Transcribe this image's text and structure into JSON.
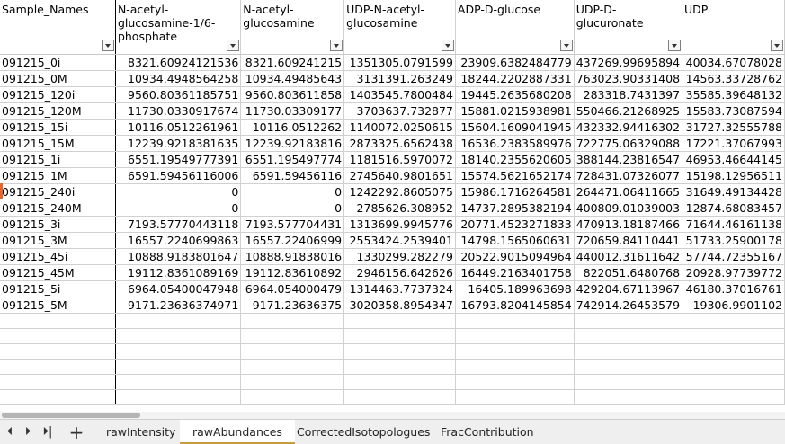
{
  "headers": [
    "Sample_Names",
    "N-acetyl-glucosamine-1/6-phosphate",
    "N-acetyl-glucosamine",
    "UDP-N-acetyl-glucosamine",
    "ADP-D-glucose",
    "UDP-D-glucuronate",
    "UDP"
  ],
  "rows": [
    [
      "091215_0i",
      "8321.60924121536",
      "8321.609241215",
      "1351305.0791599",
      "23909.6382484779",
      "437269.99695894",
      "40034.67078028"
    ],
    [
      "091215_0M",
      "10934.4948564258",
      "10934.49485643",
      "3131391.263249",
      "18244.2202887331",
      "763023.90331408",
      "14563.33728762"
    ],
    [
      "091215_120i",
      "9560.80361185751",
      "9560.803611858",
      "1403545.7800484",
      "19445.2635680208",
      "283318.7431397",
      "35585.39648132"
    ],
    [
      "091215_120M",
      "11730.0330917674",
      "11730.03309177",
      "3703637.732877",
      "15881.0215938981",
      "550466.21268925",
      "15583.73087594"
    ],
    [
      "091215_15i",
      "10116.0512261961",
      "10116.0512262",
      "1140072.0250615",
      "15604.1609041945",
      "432332.94416302",
      "31727.32555788"
    ],
    [
      "091215_15M",
      "12239.9218381635",
      "12239.92183816",
      "2873325.6562438",
      "16536.2383589976",
      "722775.06329088",
      "17221.37067993"
    ],
    [
      "091215_1i",
      "6551.19549777391",
      "6551.195497774",
      "1181516.5970072",
      "18140.2355620605",
      "388144.23816547",
      "46953.46644145"
    ],
    [
      "091215_1M",
      "6591.59456116006",
      "6591.59456116",
      "2745640.9801651",
      "15574.5621652174",
      "728431.07326077",
      "15198.12956511"
    ],
    [
      "091215_240i",
      "0",
      "0",
      "1242292.8605075",
      "15986.1716264581",
      "264471.06411665",
      "31649.49134428"
    ],
    [
      "091215_240M",
      "0",
      "0",
      "2785626.308952",
      "14737.2895382194",
      "400809.01039003",
      "12874.68083457"
    ],
    [
      "091215_3i",
      "7193.57770443118",
      "7193.577704431",
      "1313699.9945776",
      "20771.4523271833",
      "470913.18187466",
      "71644.46161138"
    ],
    [
      "091215_3M",
      "16557.2240699863",
      "16557.22406999",
      "2553424.2539401",
      "14798.1565060631",
      "720659.84110441",
      "51733.25900178"
    ],
    [
      "091215_45i",
      "10888.9183801647",
      "10888.91838016",
      "1330299.282279",
      "20522.9015094964",
      "440012.31611642",
      "57744.72355167"
    ],
    [
      "091215_45M",
      "19112.8361089169",
      "19112.83610892",
      "2946156.642626",
      "16449.2163401758",
      "822051.6480768",
      "20928.97739772"
    ],
    [
      "091215_5i",
      "6964.05400047948",
      "6964.054000479",
      "1314463.7737324",
      "16405.189963698",
      "429204.67113967",
      "46180.37016761"
    ],
    [
      "091215_5M",
      "9171.23636374971",
      "9171.23636375",
      "3020358.8954347",
      "16793.8204145854",
      "742914.26453579",
      "19306.9901102"
    ]
  ],
  "tabs": [
    "rawIntensity",
    "rawAbundances",
    "CorrectedIsotopologues",
    "FracContribution"
  ],
  "active_tab": "rawAbundances",
  "nav": {
    "prev": "⏴",
    "next": "⏵",
    "last": "⏵|",
    "add": "+"
  },
  "colors": {
    "active_tab_underline": "#c89b3c",
    "cursor_marker": "#e8662b"
  }
}
